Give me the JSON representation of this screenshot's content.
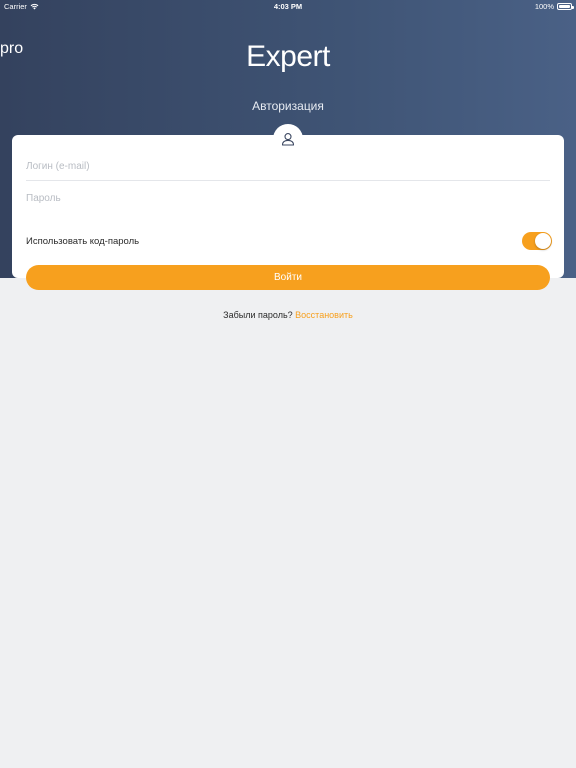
{
  "status_bar": {
    "carrier": "Carrier",
    "time": "4:03 PM",
    "battery": "100%"
  },
  "header": {
    "logo_main": "Expert",
    "logo_sub": "pro",
    "title": "Авторизация"
  },
  "form": {
    "login_placeholder": "Логин (e-mail)",
    "password_placeholder": "Пароль",
    "passcode_label": "Использовать код-пароль",
    "passcode_enabled": true,
    "submit_label": "Войти"
  },
  "footer": {
    "forgot_text": "Забыли пароль?",
    "restore_link": "Восстановить"
  },
  "colors": {
    "accent": "#f7a01e",
    "header_bg": "#3f5475",
    "page_bg": "#eff0f2"
  },
  "icons": {
    "avatar": "user-icon",
    "wifi": "wifi-icon",
    "battery": "battery-icon"
  }
}
